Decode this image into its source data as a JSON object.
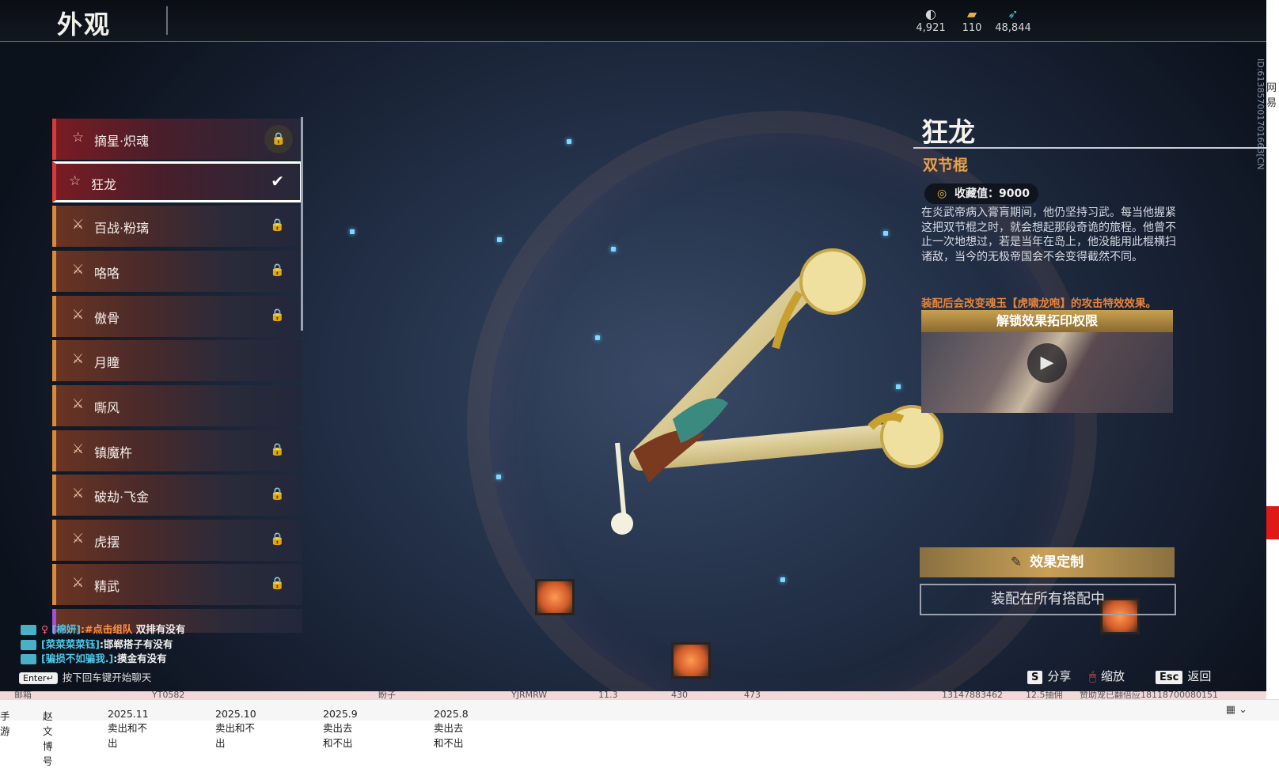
{
  "header": {
    "title": "外观"
  },
  "currencies": [
    {
      "icon": "moon-currency-icon",
      "value": "4,921"
    },
    {
      "icon": "gold-ingot-icon",
      "value": "110"
    },
    {
      "icon": "feather-icon",
      "value": "48,844"
    }
  ],
  "vertical_id": "ID:613857001701663[CN]",
  "list": {
    "items": [
      {
        "label": "摘星·炽魂",
        "locked": true
      },
      {
        "label": "狂龙",
        "selected": true
      },
      {
        "label": "百战·粉璃",
        "locked": true
      },
      {
        "label": "咯咯",
        "locked": true
      },
      {
        "label": "傲骨",
        "locked": true
      },
      {
        "label": "月瞳",
        "locked": false
      },
      {
        "label": "嘶风",
        "locked": false
      },
      {
        "label": "镇魔杵",
        "locked": true
      },
      {
        "label": "破劫·飞金",
        "locked": true
      },
      {
        "label": "虎摆",
        "locked": true
      },
      {
        "label": "精武",
        "locked": true
      }
    ]
  },
  "detail": {
    "name": "狂龙",
    "type": "双节棍",
    "collection_label": "收藏值：9000",
    "description": "在炎武帝病入膏肓期间，他仍坚持习武。每当他握紧这把双节棍之时，就会想起那段奇诡的旅程。他曾不止一次地想过，若是当年在岛上，他没能用此棍横扫诸敌，当今的无极帝国会不会变得截然不同。",
    "note": "装配后会改变魂玉【虎啸龙咆】的攻击特效效果。",
    "unlock_title": "解锁效果拓印权限",
    "custom_button": "效果定制",
    "equip_button": "装配在所有搭配中"
  },
  "chat": [
    {
      "sender": "[棉妍]",
      "msg_colored": ":#点击组队",
      "msg": " 双排有没有"
    },
    {
      "sender": "[菜菜菜菜钰]",
      "msg": ":邯郸搭子有没有"
    },
    {
      "sender": "[骗损不如骗我.]",
      "msg": ":摸金有没有"
    }
  ],
  "chat_hint": {
    "key": "Enter↵",
    "text": "按下回车键开始聊天"
  },
  "hotkeys": [
    {
      "key": "S",
      "label": "分享"
    },
    {
      "key": "🖱",
      "label": "缩放"
    },
    {
      "key": "Esc",
      "label": "返回"
    }
  ],
  "outside": {
    "side_text": "网易",
    "row_cells": [
      "邮箱",
      "YT0582",
      "盼子",
      "YJRMRW",
      "11.3",
      "430",
      "473",
      "13147883462",
      "12.5抽佣",
      "赞助宠已翻倍应18118700080151"
    ],
    "tabs": [
      "手游",
      "赵文博号",
      "2025.11卖出和不出",
      "2025.10卖出和不出",
      "2025.9卖出去和不出",
      "2025.8卖出去和不出"
    ]
  }
}
